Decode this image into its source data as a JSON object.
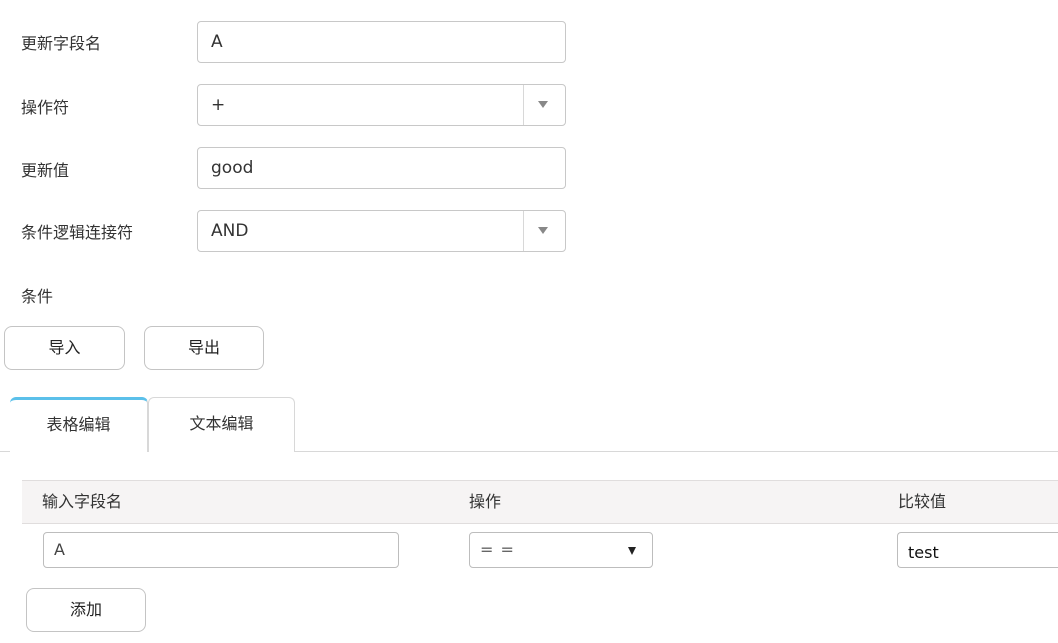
{
  "form": {
    "update_field_label": "更新字段名",
    "update_field_value": "A",
    "operator_label": "操作符",
    "operator_value": "+",
    "update_value_label": "更新值",
    "update_value_value": "good",
    "logic_label": "条件逻辑连接符",
    "logic_value": "AND",
    "condition_label": "条件"
  },
  "buttons": {
    "import_label": "导入",
    "export_label": "导出",
    "add_label": "添加"
  },
  "tabs": [
    {
      "label": "表格编辑",
      "active": true
    },
    {
      "label": "文本编辑",
      "active": false
    }
  ],
  "table": {
    "columns": [
      "输入字段名",
      "操作",
      "比较值"
    ],
    "rows": [
      {
        "field": "A",
        "operation": "= =",
        "compare": "test"
      }
    ]
  },
  "colors": {
    "active_tab_accent": "#5bc0ea",
    "header_bg": "#f6f4f4"
  },
  "icons": {
    "dropdown": "caret-down-icon"
  }
}
